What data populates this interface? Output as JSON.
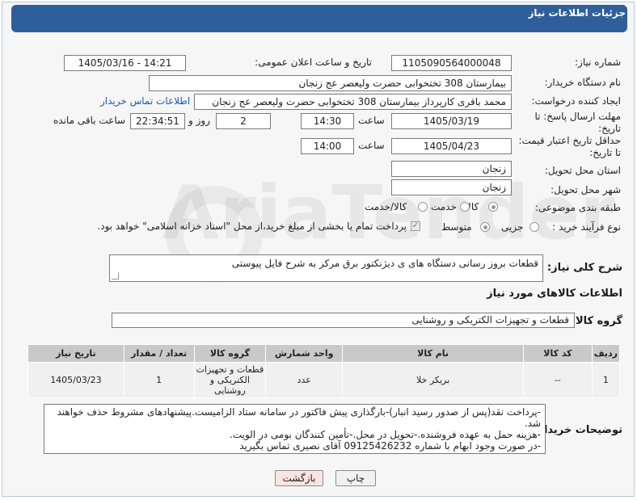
{
  "header": {
    "title": "جزئیات اطلاعات نیاز"
  },
  "fields": {
    "need_number_label": "شماره نیاز:",
    "need_number": "1105090564000048",
    "announce_label": "تاریخ و ساعت اعلان عمومی:",
    "announce_value": "1405/03/16 - 14:21",
    "buyer_org_label": "نام دستگاه خریدار:",
    "buyer_org": "بیمارستان 308 تختخوابی حضرت ولیعصر عج  زنجان",
    "creator_label": "ایجاد کننده درخواست:",
    "creator": "محمد باقری کارپرداز بیمارستان 308 تختخوابی حضرت ولیعصر عج  زنجان",
    "buyer_contact_link": "اطلاعات تماس خریدار",
    "reply_deadline_label": "مهلت ارسال پاسخ: تا تاریخ:",
    "reply_date": "1405/03/19",
    "time_label": "ساعت",
    "reply_time": "14:30",
    "days_value": "2",
    "days_label": "روز و",
    "remaining_time": "22:34:51",
    "remaining_label": "ساعت باقی مانده",
    "min_validity_label": "حداقل تاریخ اعتبار قیمت: تا تاریخ:",
    "validity_date": "1405/04/23",
    "validity_time": "14:00",
    "province_label": "استان محل تحویل:",
    "province": "زنجان",
    "city_label": "شهر محل تحویل:",
    "city": "زنجان",
    "category_label": "طبقه بندی موضوعی:",
    "category_options": [
      "کالا",
      "خدمت",
      "کالا/خدمت"
    ],
    "process_label": "نوع فرآیند خرید :",
    "process_options": [
      "جزیی",
      "متوسط"
    ],
    "payment_note": "پرداخت تمام یا بخشی از مبلغ خرید،از محل \"اسناد خزانه اسلامی\" خواهد بود.",
    "description_label": "شرح کلی نیاز:",
    "description": "قطعات بروز رسانی دستگاه های ی دیژنکتور برق مرکز به شرح فایل پیوستی",
    "goods_info_title": "اطلاعات کالاهای مورد نیاز",
    "goods_group_label": "گروه کالا:",
    "goods_group": "قطعات و تجهیزات الکتریکی و روشنایی"
  },
  "table": {
    "headers": [
      "ردیف",
      "کد کالا",
      "نام کالا",
      "واحد شمارش",
      "گروه کالا",
      "تعداد / مقدار",
      "تاریخ نیاز"
    ],
    "rows": [
      [
        "1",
        "--",
        "بریکر خلا",
        "عدد",
        "قطعات و تجهیزات الکتریکی و روشنایی",
        "1",
        "1405/03/23"
      ]
    ]
  },
  "buyer_notes_label": "توضیحات خریدار:",
  "buyer_notes": [
    "-پرداخت  نقد(پس از صدور رسید انبار)-بارگذاری پیش فاکتور در سامانه ستاد الزامیست.پیشنهادهای مشروط حذف خواهند شد.",
    "-هزینه حمل به عهده فروشنده.-تحویل در محل.-تأمین کنندگان بومی در الویت.",
    "-در صورت وجود ابهام با شماره 09125426232 آقای نصیری تماس بگیرید"
  ],
  "buttons": {
    "print": "چاپ",
    "back": "بازگشت"
  }
}
